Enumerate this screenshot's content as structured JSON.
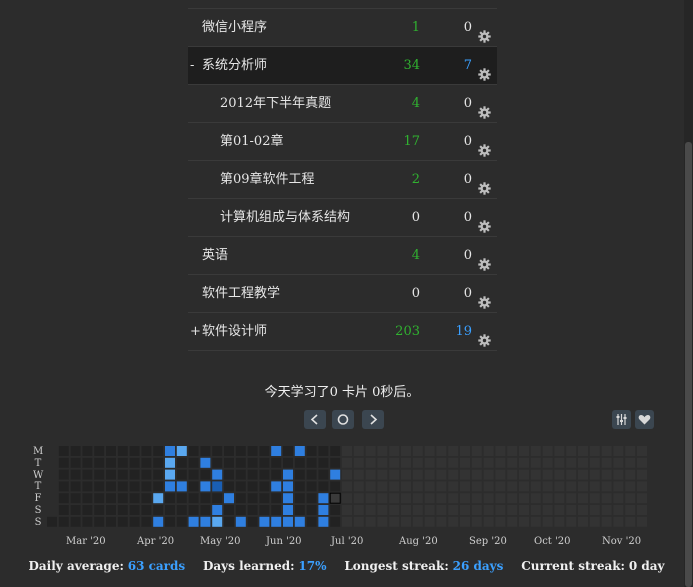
{
  "decks": [
    {
      "toggle": "",
      "name": "微信小程序",
      "due": "1",
      "new": "0",
      "level": 1
    },
    {
      "toggle": "-",
      "name": "系统分析师",
      "due": "34",
      "new": "7",
      "level": 1,
      "current": true
    },
    {
      "toggle": "",
      "name": "2012年下半年真题",
      "due": "4",
      "new": "0",
      "level": 2
    },
    {
      "toggle": "",
      "name": "第01-02章",
      "due": "17",
      "new": "0",
      "level": 2
    },
    {
      "toggle": "",
      "name": "第09章软件工程",
      "due": "2",
      "new": "0",
      "level": 2
    },
    {
      "toggle": "",
      "name": "计算机组成与体系结构",
      "due": "0",
      "new": "0",
      "level": 2
    },
    {
      "toggle": "",
      "name": "英语",
      "due": "4",
      "new": "0",
      "level": 1
    },
    {
      "toggle": "",
      "name": "软件工程教学",
      "due": "0",
      "new": "0",
      "level": 1
    },
    {
      "toggle": "+",
      "name": "软件设计师",
      "due": "203",
      "new": "19",
      "level": 1
    }
  ],
  "studied_today": "今天学习了0 卡片 0秒后。",
  "heatmap": {
    "day_labels": [
      "M",
      "T",
      "W",
      "T",
      "F",
      "S",
      "S"
    ],
    "months": [
      "Mar '20",
      "Apr '20",
      "May '20",
      "Jun '20",
      "Jul '20",
      "Aug '20",
      "Sep '20",
      "Oct '20",
      "Nov '20"
    ],
    "colors": {
      "empty": "#222222",
      "future": "#333333",
      "low": "#1a5fb4",
      "mid": "#2f7fe0",
      "high": "#5aa8f0",
      "today_border": "#000000"
    }
  },
  "stats": {
    "daily_average_label": "Daily average:",
    "daily_average_value": "63 cards",
    "days_learned_label": "Days learned:",
    "days_learned_value": "17%",
    "longest_streak_label": "Longest streak:",
    "longest_streak_value": "26 days",
    "current_streak_label": "Current streak:",
    "current_streak_value": "0 day"
  }
}
